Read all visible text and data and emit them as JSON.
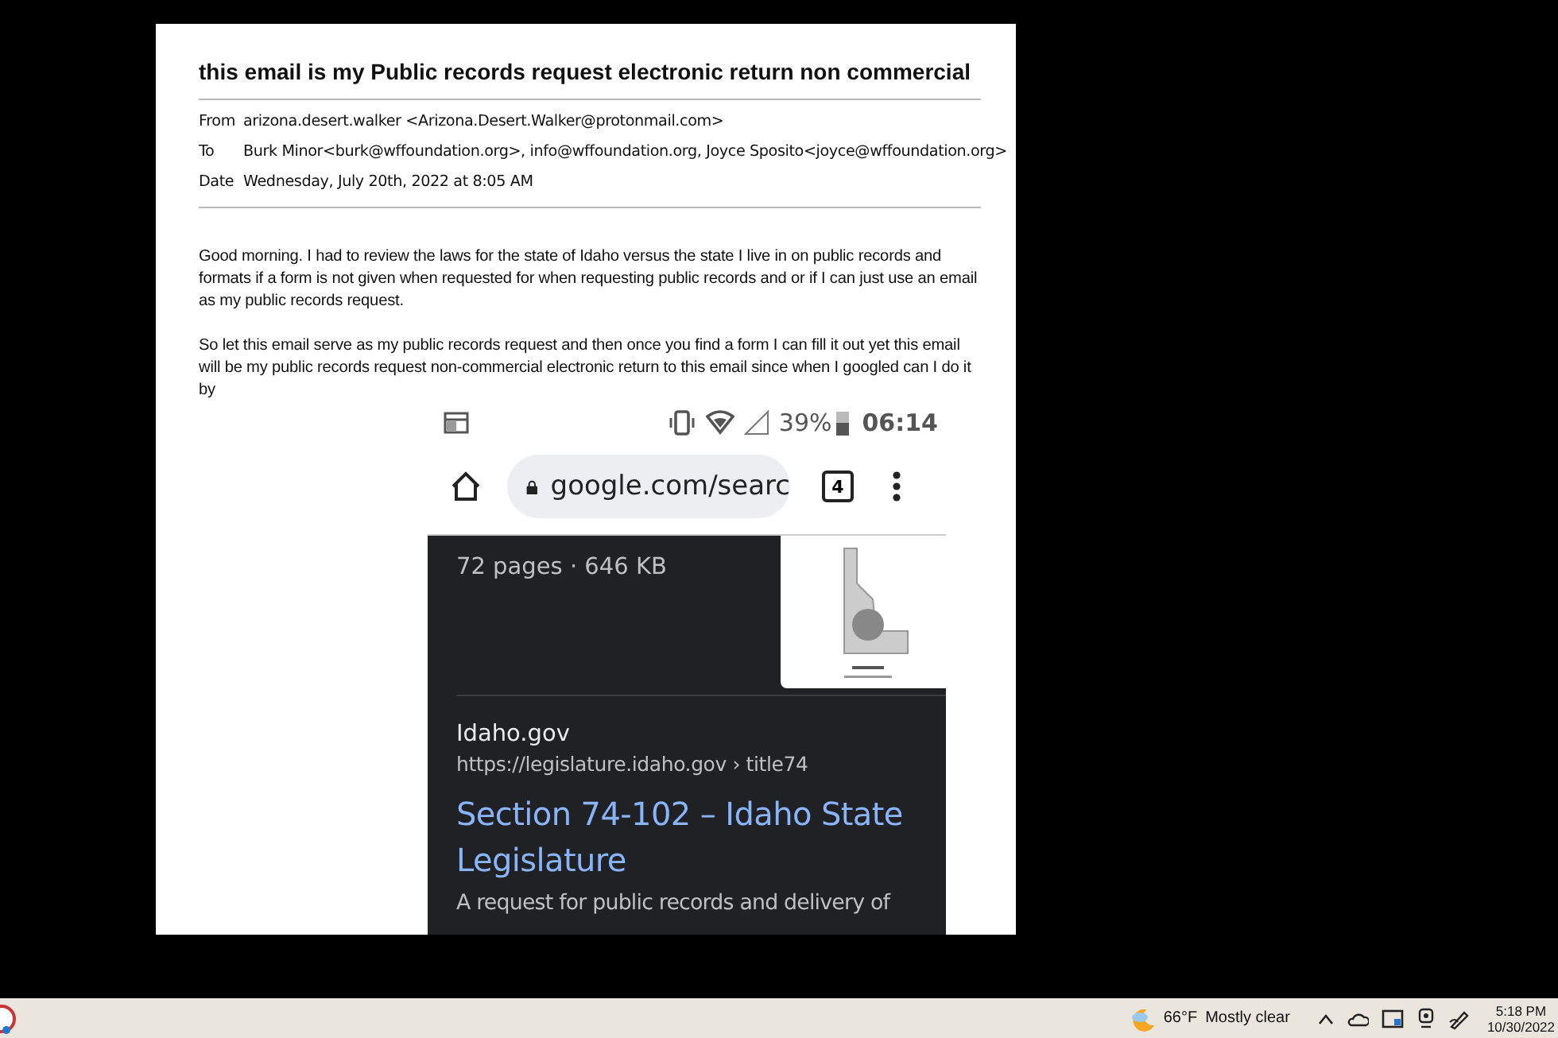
{
  "email": {
    "subject": "this email is my Public records request electronic return non commercial",
    "headers": [
      {
        "label": "From",
        "value": "arizona.desert.walker <Arizona.Desert.Walker@protonmail.com>"
      },
      {
        "label": "To",
        "value": "Burk Minor<burk@wffoundation.org>, info@wffoundation.org, Joyce Sposito<joyce@wffoundation.org>"
      },
      {
        "label": "Date",
        "value": "Wednesday, July 20th, 2022 at 8:05 AM"
      }
    ],
    "paragraphs": [
      "Good morning. I had to review the laws for the state of Idaho versus the state I live in on public records and formats if a form is not given when requested for when requesting public records and or if I can just use an email as my public records request.",
      "So let this email serve as my public records request and then once you find a form I can fill it out yet this email will be my public records request non-commercial electronic return to this email since when I googled can I do it by"
    ]
  },
  "phone": {
    "status": {
      "battery": "39%",
      "time": "06:14"
    },
    "browser": {
      "url": "google.com/searc",
      "tab_count": "4"
    },
    "result": {
      "meta": "72 pages · 646 KB",
      "source": "Idaho.gov",
      "url": "https://legislature.idaho.gov › title74",
      "title": "Section 74-102 – Idaho State Legislature",
      "snippet": "A request for public records and delivery of"
    }
  },
  "taskbar": {
    "weather": {
      "temp": "66°F",
      "condition": "Mostly clear"
    },
    "time": "5:18 PM",
    "date": "10/30/2022"
  }
}
